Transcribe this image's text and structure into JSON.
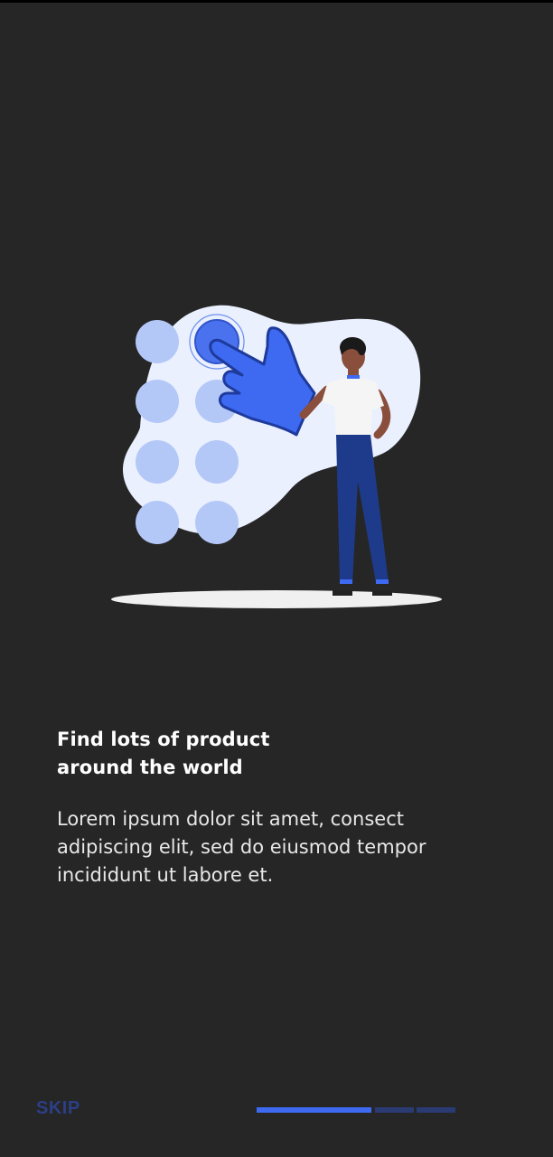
{
  "onboarding": {
    "title_lines": [
      "Find lots of product",
      "around the world"
    ],
    "description_lines": [
      "Lorem ipsum dolor sit amet, consect",
      "adipiscing elit, sed do eiusmod tempor",
      "incididunt ut labore et."
    ],
    "skip_label": "SKIP",
    "illustration": "person-tapping-app-grid-illustration"
  },
  "pager": {
    "current_page": 1,
    "total_pages": 3
  },
  "colors": {
    "background": "#262626",
    "accent": "#3d6af0",
    "indicator_inactive": "#2a3a73",
    "skip_text": "#2b3f86",
    "blob": "#eaf0fe",
    "dot": "#b4c8f8"
  }
}
